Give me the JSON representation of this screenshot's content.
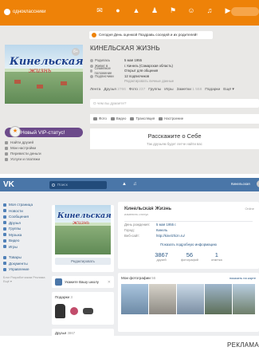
{
  "ok": {
    "logo": "одноклассники",
    "nav_icons": [
      "envelope-icon",
      "chat-icon",
      "bell-icon",
      "friends-icon",
      "guests-icon",
      "events-icon",
      "music-icon",
      "video-icon"
    ],
    "notification": "Сегодня День оценкой Поздравь соседей и их родителей!",
    "profile_name": "КИНЕЛЬСКАЯ ЖИЗНЬ",
    "avatar_title": "Кинельская",
    "avatar_subtitle": "жизнь",
    "avatar_badge": "8+",
    "vip_label": "Новый VIP-статус!",
    "info": [
      {
        "key": "Родилась",
        "value": "5 мая 1955"
      },
      {
        "key": "Живет в",
        "value": "г. Кинель (Самарская область)"
      },
      {
        "key": "Семейное положение",
        "value": "Открыт для общения"
      },
      {
        "key": "Подписчики",
        "value": "12 подписчиков"
      }
    ],
    "edit_info": "Редактировать личные данные",
    "tabs": [
      {
        "label": "Лента",
        "count": ""
      },
      {
        "label": "Друзья",
        "count": "2766"
      },
      {
        "label": "Фото",
        "count": "237"
      },
      {
        "label": "Группы",
        "count": ""
      },
      {
        "label": "Игры",
        "count": ""
      },
      {
        "label": "Заметки",
        "count": "1 558"
      },
      {
        "label": "Подарки",
        "count": ""
      },
      {
        "label": "Ещё ▾",
        "count": ""
      }
    ],
    "post_placeholder": "О чем вы думаете?",
    "actions": [
      "Фото",
      "Видео",
      "Трансляция",
      "Настроение"
    ],
    "about_title": "Расскажите о Себе",
    "about_subtitle": "Так друзьям будет легче найти вас",
    "left_menu": [
      "Найти друзей",
      "Мои настройки",
      "Перевести деньги",
      "Услуги и платежи"
    ]
  },
  "vk": {
    "logo": "VK",
    "search_placeholder": "Поиск",
    "user_label": "Кинельская",
    "sidebar": [
      "Моя страница",
      "Новости",
      "Сообщения",
      "Друзья",
      "Группы",
      "Музыка",
      "Видео",
      "Игры"
    ],
    "sidebar2": [
      "Товары",
      "Документы",
      "Управление"
    ],
    "sidebar_footer": "Блог  Разработчикам  Реклама  Ещё ▾",
    "avatar_title": "Кинельская",
    "avatar_subtitle": "жизнь",
    "edit_button": "Редактировать",
    "school_card": "Укажите Вашу школу",
    "gifts_label": "Подарки",
    "gifts_count": "3",
    "friends_label": "Друзья",
    "friends_count": "3867",
    "name": "Кинельская Жизнь",
    "status": "изменить статус",
    "online": "Online",
    "fields": [
      {
        "key": "День рождения:",
        "value": "5 мая 1955 г."
      },
      {
        "key": "Город:",
        "value": "Кинель"
      },
      {
        "key": "Веб-сайт:",
        "value": "http://kinelzhizn.ru/"
      }
    ],
    "more_info": "Показать подробную информацию",
    "stats": [
      {
        "num": "3867",
        "label": "друзей"
      },
      {
        "num": "56",
        "label": "фотографий"
      },
      {
        "num": "1",
        "label": "отметка"
      }
    ],
    "photos_label": "Мои фотографии",
    "photos_count": "56",
    "photos_link": "показать на карте"
  },
  "caption": "РЕКЛАМА"
}
